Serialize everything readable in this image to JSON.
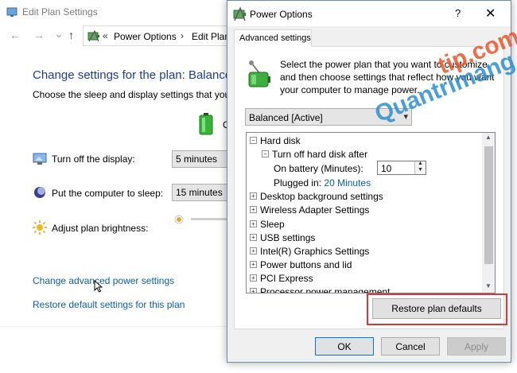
{
  "background_window": {
    "title": "Edit Plan Settings",
    "nav": {
      "back": "←",
      "forward": "→",
      "recent": "⌄",
      "up": "↑"
    },
    "address": {
      "chevron": "«",
      "crumb1": "Power Options",
      "separator": "›",
      "crumb2": "Edit Plan"
    },
    "heading": "Change settings for the plan: Balance",
    "subheading": "Choose the sleep and display settings that you w",
    "column_label": "O",
    "rows": [
      {
        "label": "Turn off the display:",
        "value": "5 minutes",
        "icon": "monitor-icon"
      },
      {
        "label": "Put the computer to sleep:",
        "value": "15 minutes",
        "icon": "moon-icon"
      },
      {
        "label": "Adjust plan brightness:",
        "icon": "sun-icon"
      }
    ],
    "links": {
      "advanced": "Change advanced power settings",
      "restore": "Restore default settings for this plan"
    }
  },
  "dialog": {
    "title": "Power Options",
    "help": "?",
    "close": "✕",
    "tab": "Advanced settings",
    "description": [
      "Select the power plan that you want to customize,",
      "and then choose settings that reflect how you want",
      "your computer to manage power."
    ],
    "plan_select": {
      "value": "Balanced [Active]",
      "arrow": "▾"
    },
    "tree": {
      "expanded_symbol": "−",
      "collapsed_symbol": "+",
      "items": [
        {
          "label": "Hard disk",
          "level": 0,
          "state": "expanded"
        },
        {
          "label": "Turn off hard disk after",
          "level": 1,
          "state": "expanded"
        },
        {
          "label": "On battery (Minutes):",
          "level": 2,
          "state": "leaf",
          "spin_value": "10"
        },
        {
          "label": "Plugged in:",
          "level": 2,
          "state": "leaf",
          "link_value": "20 Minutes"
        },
        {
          "label": "Desktop background settings",
          "level": 0,
          "state": "collapsed"
        },
        {
          "label": "Wireless Adapter Settings",
          "level": 0,
          "state": "collapsed"
        },
        {
          "label": "Sleep",
          "level": 0,
          "state": "collapsed"
        },
        {
          "label": "USB settings",
          "level": 0,
          "state": "collapsed"
        },
        {
          "label": "Intel(R) Graphics Settings",
          "level": 0,
          "state": "collapsed"
        },
        {
          "label": "Power buttons and lid",
          "level": 0,
          "state": "collapsed"
        },
        {
          "label": "PCI Express",
          "level": 0,
          "state": "collapsed"
        },
        {
          "label": "Processor power management",
          "level": 0,
          "state": "collapsed"
        }
      ],
      "scroll_up": "▲",
      "scroll_down": "▼",
      "spin_up": "▲",
      "spin_down": "▼"
    },
    "buttons": {
      "restore": "Restore plan defaults",
      "ok": "OK",
      "cancel": "Cancel",
      "apply": "Apply"
    }
  },
  "watermark": {
    "text": "Quantrimang.com",
    "brand": "tip.com"
  },
  "colors": {
    "heading_blue": "#1e3c96",
    "link_blue": "#0b5fa8",
    "highlight_red": "#d9383a",
    "watermark_orange": "#e8572a",
    "watermark_blue": "#2d8fd0"
  }
}
